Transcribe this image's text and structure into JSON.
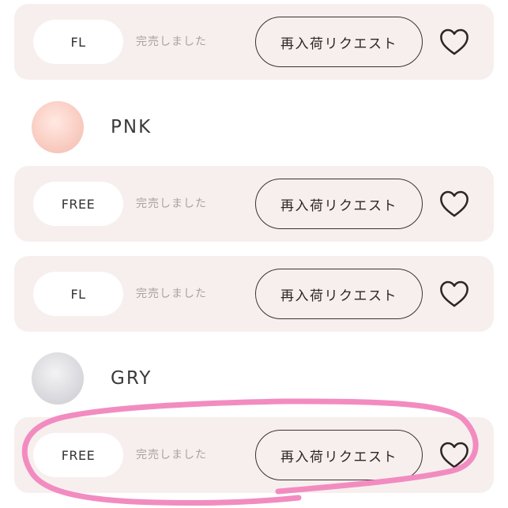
{
  "rows": [
    {
      "size": "FL",
      "status": "完売しました",
      "button": "再入荷リクエスト",
      "favorite": "heart-outline-icon"
    },
    {
      "size": "FREE",
      "status": "完売しました",
      "button": "再入荷リクエスト",
      "favorite": "heart-outline-icon"
    },
    {
      "size": "FL",
      "status": "完売しました",
      "button": "再入荷リクエスト",
      "favorite": "heart-outline-icon"
    },
    {
      "size": "FREE",
      "status": "完売しました",
      "button": "再入荷リクエスト",
      "favorite": "heart-outline-icon"
    }
  ],
  "colors": [
    {
      "name": "PNK",
      "swatch": "#f6c3b7"
    },
    {
      "name": "GRY",
      "swatch": "#d4d4d8"
    }
  ],
  "theme": {
    "row_background": "#f7efed",
    "button_border": "#3b3131",
    "annotation_stroke": "#f28cc0"
  }
}
